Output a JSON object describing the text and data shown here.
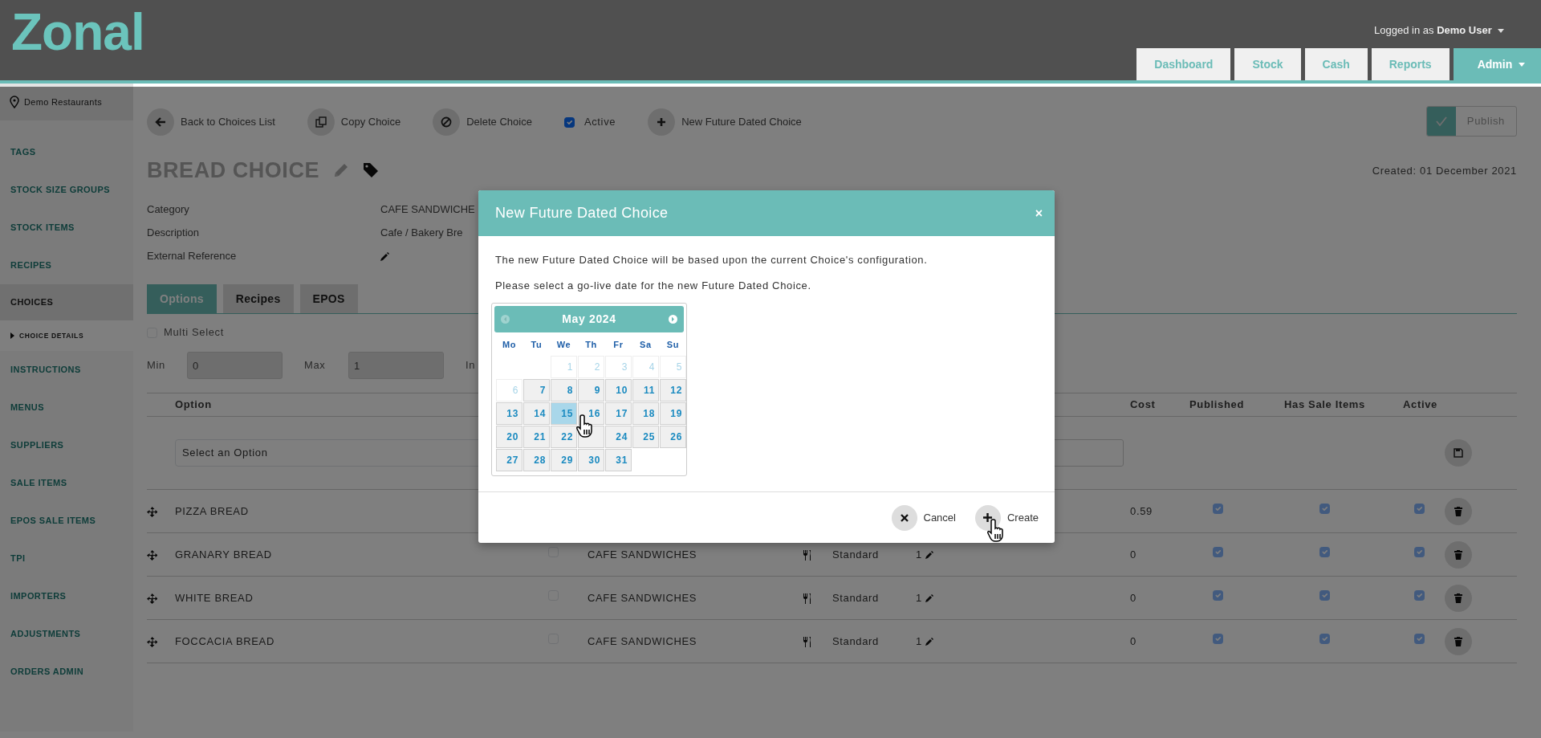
{
  "header": {
    "logo": "Zonal",
    "user_label": "Logged in as",
    "user_name": "Demo User",
    "nav": [
      {
        "label": "Dashboard",
        "selected": false,
        "has_menu": false
      },
      {
        "label": "Stock",
        "selected": false,
        "has_menu": false
      },
      {
        "label": "Cash",
        "selected": false,
        "has_menu": false
      },
      {
        "label": "Reports",
        "selected": false,
        "has_menu": false
      },
      {
        "label": "Admin",
        "selected": true,
        "has_menu": true
      }
    ]
  },
  "sidebar": {
    "location": "Demo Restaurants",
    "items": [
      {
        "label": "TAGS",
        "selected": false
      },
      {
        "label": "STOCK SIZE GROUPS",
        "selected": false
      },
      {
        "label": "STOCK ITEMS",
        "selected": false
      },
      {
        "label": "RECIPES",
        "selected": false
      },
      {
        "label": "CHOICES",
        "selected": true,
        "expanded": true,
        "children": [
          {
            "label": "CHOICE DETAILS",
            "selected": true
          }
        ]
      },
      {
        "label": "INSTRUCTIONS",
        "selected": false
      },
      {
        "label": "MENUS",
        "selected": false
      },
      {
        "label": "SUPPLIERS",
        "selected": false
      },
      {
        "label": "SALE ITEMS",
        "selected": false
      },
      {
        "label": "EPOS SALE ITEMS",
        "selected": false
      },
      {
        "label": "TPI",
        "selected": false
      },
      {
        "label": "IMPORTERS",
        "selected": false
      },
      {
        "label": "ADJUSTMENTS",
        "selected": false
      },
      {
        "label": "ORDERS ADMIN",
        "selected": false
      }
    ]
  },
  "toolbar": [
    {
      "kind": "back",
      "label": "Back to Choices List"
    },
    {
      "kind": "copy",
      "label": "Copy Choice"
    },
    {
      "kind": "delete",
      "label": "Delete Choice"
    },
    {
      "kind": "checkbox",
      "label": "Active",
      "checked": true
    },
    {
      "kind": "add",
      "label": "New Future Dated Choice"
    }
  ],
  "publish": {
    "label": "Publish",
    "on": true
  },
  "title": "BREAD CHOICE",
  "created": "Created: 01 December 2021",
  "details": [
    {
      "label": "Category",
      "value": "CAFE SANDWICHE"
    },
    {
      "label": "Description",
      "value": "Cafe / Bakery Bre"
    },
    {
      "label": "External Reference",
      "kind": "edit"
    }
  ],
  "tabs": [
    {
      "label": "Options",
      "selected": true
    },
    {
      "label": "Recipes",
      "selected": false
    },
    {
      "label": "EPOS",
      "selected": false
    }
  ],
  "multi_select": {
    "label": "Multi Select",
    "checked": false
  },
  "limits": [
    {
      "label": "Min",
      "value": "0"
    },
    {
      "label": "Max",
      "value": "1"
    },
    {
      "label": "In"
    }
  ],
  "table": {
    "columns": [
      "Option",
      "Cost",
      "Published",
      "Has Sale Items",
      "Active"
    ],
    "new_row": {
      "value": "Select an Option"
    },
    "rows": [
      {
        "name": "PIZZA BREAD",
        "cost": "0.59",
        "published": true,
        "has_sale_items": true,
        "active": true
      },
      {
        "name": "GRANARY BREAD",
        "column_3_checked": false,
        "category": "CAFE SANDWICHES",
        "type": "Standard",
        "quantity": "1",
        "cost": "0",
        "published": true,
        "has_sale_items": true,
        "active": true
      },
      {
        "name": "WHITE BREAD",
        "column_3_checked": false,
        "category": "CAFE SANDWICHES",
        "type": "Standard",
        "quantity": "1",
        "cost": "0",
        "published": true,
        "has_sale_items": true,
        "active": true
      },
      {
        "name": "FOCCACIA BREAD",
        "column_3_checked": false,
        "category": "CAFE SANDWICHES",
        "type": "Standard",
        "quantity": "1",
        "cost": "0",
        "published": true,
        "has_sale_items": true,
        "active": true
      }
    ]
  },
  "modal": {
    "title": "New Future Dated Choice",
    "close": "×",
    "lines": [
      "The new Future Dated Choice will be based upon the current Choice's configuration.",
      "Please select a go-live date for the new Future Dated Choice."
    ],
    "calendar": {
      "month": "May 2024",
      "prev_disabled": true,
      "next_disabled": false,
      "weekdays": [
        "Mo",
        "Tu",
        "We",
        "Th",
        "Fr",
        "Sa",
        "Su"
      ],
      "weeks": [
        [
          {
            "label": "1",
            "disabled": true,
            "selected": false
          },
          {
            "label": "2",
            "disabled": true,
            "selected": false
          },
          {
            "label": "3",
            "disabled": true,
            "selected": false
          },
          {
            "label": "4",
            "disabled": true,
            "selected": false
          },
          {
            "label": "5",
            "disabled": true,
            "selected": false
          }
        ],
        [
          {
            "label": "6",
            "disabled": true,
            "selected": false
          },
          {
            "label": "7",
            "disabled": false,
            "selected": false
          },
          {
            "label": "8",
            "disabled": false,
            "selected": false
          },
          {
            "label": "9",
            "disabled": false,
            "selected": false
          },
          {
            "label": "10",
            "disabled": false,
            "selected": false
          },
          {
            "label": "11",
            "disabled": false,
            "selected": false
          },
          {
            "label": "12",
            "disabled": false,
            "selected": false
          }
        ],
        [
          {
            "label": "13",
            "disabled": false,
            "selected": false
          },
          {
            "label": "14",
            "disabled": false,
            "selected": false
          },
          {
            "label": "15",
            "disabled": false,
            "selected": true
          },
          {
            "label": "16",
            "disabled": false,
            "selected": false
          },
          {
            "label": "17",
            "disabled": false,
            "selected": false
          },
          {
            "label": "18",
            "disabled": false,
            "selected": false
          },
          {
            "label": "19",
            "disabled": false,
            "selected": false
          }
        ],
        [
          {
            "label": "20",
            "disabled": false,
            "selected": false
          },
          {
            "label": "21",
            "disabled": false,
            "selected": false
          },
          {
            "label": "22",
            "disabled": false,
            "selected": false
          },
          {
            "disabled": false,
            "selected": false
          },
          {
            "label": "24",
            "disabled": false,
            "selected": false
          },
          {
            "label": "25",
            "disabled": false,
            "selected": false
          },
          {
            "label": "26",
            "disabled": false,
            "selected": false
          }
        ],
        [
          {
            "label": "27",
            "disabled": false,
            "selected": false
          },
          {
            "label": "28",
            "disabled": false,
            "selected": false
          },
          {
            "label": "29",
            "disabled": false,
            "selected": false
          },
          {
            "label": "30",
            "disabled": false,
            "selected": false
          },
          {
            "label": "31",
            "disabled": false,
            "selected": false
          }
        ]
      ]
    },
    "buttons": [
      {
        "kind": "cancel",
        "label": "Cancel"
      },
      {
        "kind": "create",
        "label": "Create"
      }
    ]
  }
}
